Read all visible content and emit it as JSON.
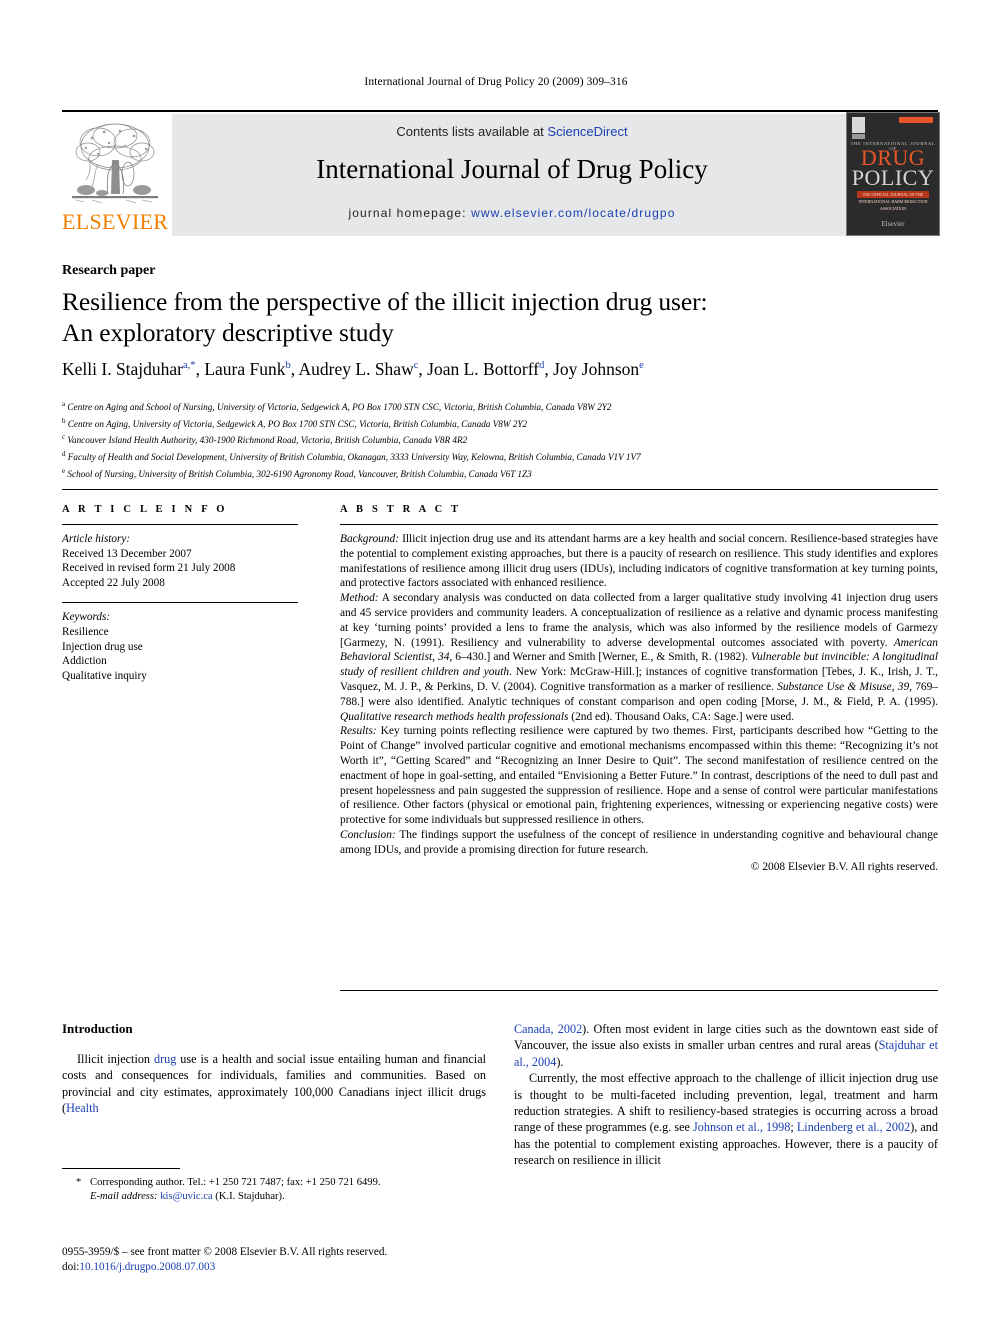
{
  "running_head": "International Journal of Drug Policy 20 (2009) 309–316",
  "masthead": {
    "publisher_name": "ELSEVIER",
    "contents_prefix": "Contents lists available at ",
    "contents_link": "ScienceDirect",
    "journal_title": "International Journal of Drug Policy",
    "homepage_prefix": "journal homepage: ",
    "homepage_url": "www.elsevier.com/locate/drugpo"
  },
  "cover": {
    "eyebrow": "THE INTERNATIONAL JOURNAL OF",
    "line1": "DRUG",
    "line2": "POLICY",
    "redline": "THE OFFICIAL JOURNAL OF THE INTERNATIONAL HARM REDUCTION ASSOCIATION",
    "footer": "Elsevier"
  },
  "article": {
    "type": "Research paper",
    "title_line1": "Resilience from the perspective of the illicit injection drug user:",
    "title_line2": "An exploratory descriptive study",
    "authors": [
      {
        "name": "Kelli I. Stajduhar",
        "marks": "a,*"
      },
      {
        "name": "Laura Funk",
        "marks": "b"
      },
      {
        "name": "Audrey L. Shaw",
        "marks": "c"
      },
      {
        "name": "Joan L. Bottorff",
        "marks": "d"
      },
      {
        "name": "Joy Johnson",
        "marks": "e"
      }
    ],
    "affiliations": [
      {
        "mark": "a",
        "text": "Centre on Aging and School of Nursing, University of Victoria, Sedgewick A, PO Box 1700 STN CSC, Victoria, British Columbia, Canada V8W 2Y2"
      },
      {
        "mark": "b",
        "text": "Centre on Aging, University of Victoria, Sedgewick A, PO Box 1700 STN CSC, Victoria, British Columbia, Canada V8W 2Y2"
      },
      {
        "mark": "c",
        "text": "Vancouver Island Health Authority, 430-1900 Richmond Road, Victoria, British Columbia, Canada V8R 4R2"
      },
      {
        "mark": "d",
        "text": "Faculty of Health and Social Development, University of British Columbia, Okanagan, 3333 University Way, Kelowna, British Columbia, Canada V1V 1V7"
      },
      {
        "mark": "e",
        "text": "School of Nursing, University of British Columbia, 302-6190 Agronomy Road, Vancouver, British Columbia, Canada V6T 1Z3"
      }
    ]
  },
  "article_info": {
    "heading": "A R T I C L E   I N F O",
    "history_label": "Article history:",
    "history": [
      "Received 13 December 2007",
      "Received in revised form 21 July 2008",
      "Accepted 22 July 2008"
    ],
    "keywords_label": "Keywords:",
    "keywords": [
      "Resilience",
      "Injection drug use",
      "Addiction",
      "Qualitative inquiry"
    ]
  },
  "abstract": {
    "heading": "A B S T R A C T",
    "background_label": "Background:",
    "background_text": " Illicit injection drug use and its attendant harms are a key health and social concern. Resilience-based strategies have the potential to complement existing approaches, but there is a paucity of research on resilience. This study identifies and explores manifestations of resilience among illicit drug users (IDUs), including indicators of cognitive transformation at key turning points, and protective factors associated with enhanced resilience.",
    "method_label": "Method:",
    "method_p1": " A secondary analysis was conducted on data collected from a larger qualitative study involving 41 injection drug users and 45 service providers and community leaders. A conceptualization of resilience as a relative and dynamic process manifesting at key ‘turning points’ provided a lens to frame the analysis, which was also informed by the resilience models of Garmezy [Garmezy, N. (1991). Resiliency and vulnerability to adverse developmental outcomes associated with poverty. ",
    "method_it1": "American Behavioral Scientist, 34,",
    "method_p2": " 6–430.] and Werner and Smith [Werner, E., & Smith, R. (1982). ",
    "method_it2": "Vulnerable but invincible: A longitudinal study of resilient children and youth",
    "method_p3": ". New York: McGraw-Hill.]; instances of cognitive transformation [Tebes, J. K., Irish, J. T., Vasquez, M. J. P., & Perkins, D. V. (2004). Cognitive transformation as a marker of resilience. ",
    "method_it3": "Substance Use & Misuse, 39",
    "method_p4": ", 769–788.] were also identified. Analytic techniques of constant comparison and open coding [Morse, J. M., & Field, P. A. (1995). ",
    "method_it4": "Qualitative research methods health professionals",
    "method_p5": " (2nd ed). Thousand Oaks, CA: Sage.] were used.",
    "results_label": "Results:",
    "results_text": " Key turning points reflecting resilience were captured by two themes. First, participants described how “Getting to the Point of Change” involved particular cognitive and emotional mechanisms encompassed within this theme: “Recognizing it’s not Worth it”, “Getting Scared” and “Recognizing an Inner Desire to Quit”. The second manifestation of resilience centred on the enactment of hope in goal-setting, and entailed “Envisioning a Better Future.” In contrast, descriptions of the need to dull past and present hopelessness and pain suggested the suppression of resilience. Hope and a sense of control were particular manifestations of resilience. Other factors (physical or emotional pain, frightening experiences, witnessing or experiencing negative costs) were protective for some individuals but suppressed resilience in others.",
    "conclusion_label": "Conclusion:",
    "conclusion_text": " The findings support the usefulness of the concept of resilience in understanding cognitive and behavioural change among IDUs, and provide a promising direction for future research.",
    "copyright": "© 2008 Elsevier B.V. All rights reserved."
  },
  "body": {
    "intro_heading": "Introduction",
    "left_p1_a": "Illicit injection ",
    "left_p1_link1": "drug",
    "left_p1_b": " use is a health and social issue entailing human and financial costs and consequences for individuals, families and communities. Based on provincial and city estimates, approximately 100,000 Canadians inject illicit drugs (",
    "left_p1_link2": "Health",
    "right_p1_link1": "Canada, 2002",
    "right_p1_a": "). Often most evident in large cities such as the downtown east side of Vancouver, the issue also exists in smaller urban centres and rural areas (",
    "right_p1_link2": "Stajduhar et al., 2004",
    "right_p1_b": ").",
    "right_p2_a": "Currently, the most effective approach to the challenge of illicit injection drug use is thought to be multi-faceted including prevention, legal, treatment and harm reduction strategies. A shift to resiliency-based strategies is occurring across a broad range of these programmes (e.g. see ",
    "right_p2_link1": "Johnson et al., 1998",
    "right_p2_mid": "; ",
    "right_p2_link2": "Lindenberg et al., 2002",
    "right_p2_b": "), and has the potential to complement existing approaches. However, there is a paucity of research on resilience in illicit"
  },
  "footnotes": {
    "star": "*",
    "corresponding": "Corresponding author. Tel.: +1 250 721 7487; fax: +1 250 721 6499.",
    "email_label": "E-mail address:",
    "email": "kis@uvic.ca",
    "email_owner": " (K.I. Stajduhar).",
    "issn_line": "0955-3959/$ – see front matter © 2008 Elsevier B.V. All rights reserved.",
    "doi_label": "doi:",
    "doi_value": "10.1016/j.drugpo.2008.07.003"
  },
  "colors": {
    "link_blue": "#1a3fb0",
    "elsevier_orange": "#F08000",
    "banner_gray": "#e6e7e8"
  }
}
